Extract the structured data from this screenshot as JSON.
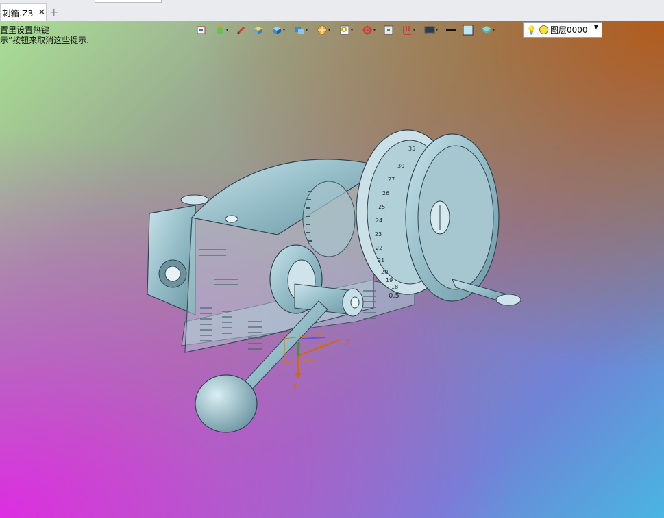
{
  "tabs": [
    {
      "label": "刺箱.Z3",
      "close": "✕"
    }
  ],
  "tab_add": "+",
  "hint": {
    "line1": "置里设置热键",
    "line2": "示”按钮来取消这些提示."
  },
  "toolbar": {
    "icons": [
      "view-orient-icon",
      "render-mode-icon",
      "draw-pen-icon",
      "solid-view-icon",
      "box-view-icon",
      "section-view-icon",
      "filter-wheel-icon",
      "zoom-fit-icon",
      "pick-filter-icon",
      "snapshot-icon",
      "grid-icon",
      "display-icon",
      "line-color-icon",
      "fill-color-icon",
      "layer-display-icon"
    ],
    "layer": {
      "name": "图层0000",
      "icon": "bulb-icon"
    }
  },
  "axes": {
    "x_label": "",
    "y_label": "Y",
    "z_label": "Z"
  },
  "dial_text": [
    "35",
    "30",
    "27",
    "26",
    "25",
    "24",
    "23",
    "22",
    "21",
    "20",
    "19",
    "18",
    "0.5"
  ]
}
